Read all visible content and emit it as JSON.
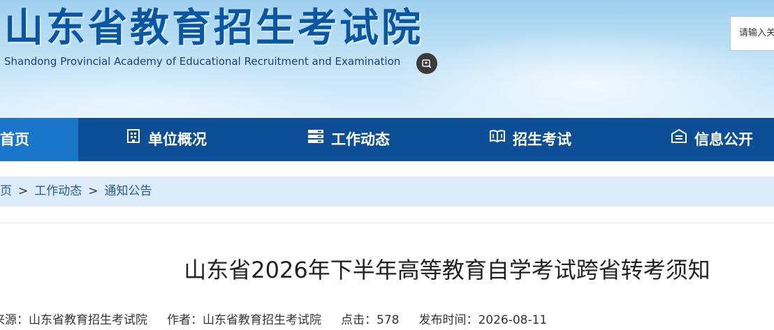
{
  "header": {
    "title_cn": "山东省教育招生考试院",
    "title_en": "Shandong Provincial Academy of Educational Recruitment and Examination",
    "care_icon": "accessibility-icon",
    "search_placeholder": "请输入关键字"
  },
  "nav": {
    "items": [
      {
        "label": "首页",
        "icon": "home",
        "active": true
      },
      {
        "label": "单位概况",
        "icon": "building-icon"
      },
      {
        "label": "工作动态",
        "icon": "news-icon"
      },
      {
        "label": "招生考试",
        "icon": "book-icon"
      },
      {
        "label": "信息公开",
        "icon": "info-icon"
      }
    ]
  },
  "breadcrumb": {
    "items": [
      "首页",
      "工作动态",
      "通知公告"
    ],
    "separator": ">"
  },
  "article": {
    "title": "山东省2026年下半年高等教育自学考试跨省转考须知",
    "source": "来源：山东省教育招生考试院",
    "author": "作者：山东省教育招生考试院",
    "clicks": "点击：578",
    "publish_time": "发布时间：2026-08-11"
  },
  "colors": {
    "nav_bg": "#0c4f96",
    "nav_active": "#1a76c8",
    "breadcrumb_bg": "#dcecfb",
    "logo": "#0b56a3"
  }
}
